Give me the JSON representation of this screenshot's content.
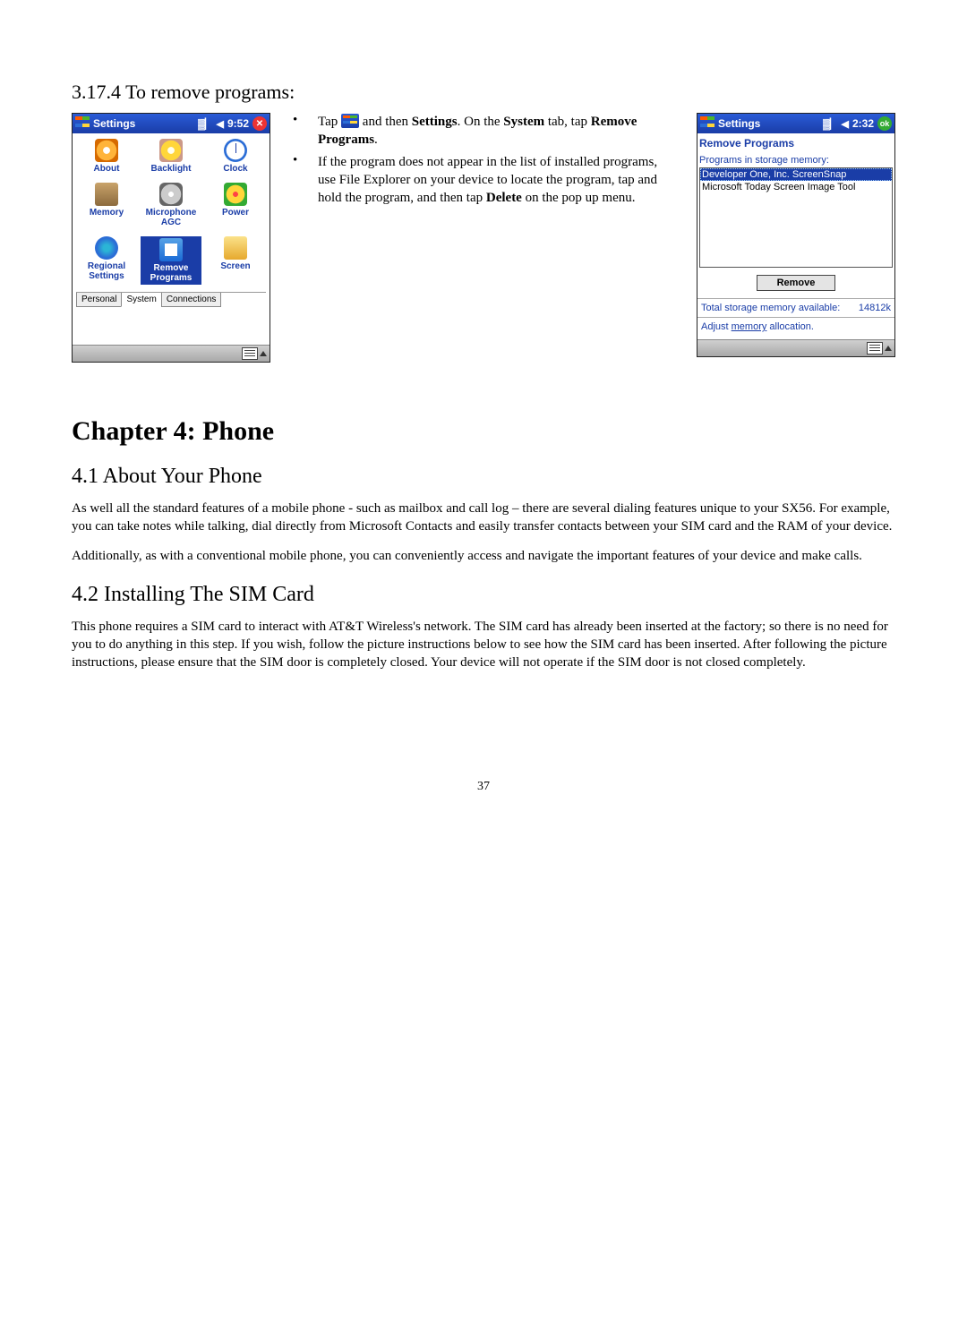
{
  "section_heading": "3.17.4  To remove programs:",
  "settings_screen": {
    "title": "Settings",
    "time": "9:52",
    "close_symbol": "✕",
    "icons": [
      {
        "label": "About",
        "name": "about-icon",
        "cls": "gi-about"
      },
      {
        "label": "Backlight",
        "name": "backlight-icon",
        "cls": "gi-backlight"
      },
      {
        "label": "Clock",
        "name": "clock-icon",
        "cls": "gi-clock"
      },
      {
        "label": "Memory",
        "name": "memory-icon",
        "cls": "gi-memory"
      },
      {
        "label": "Microphone AGC",
        "name": "microphone-icon",
        "cls": "gi-mic"
      },
      {
        "label": "Power",
        "name": "power-icon",
        "cls": "gi-power"
      },
      {
        "label": "Regional Settings",
        "name": "regional-icon",
        "cls": "gi-regional"
      },
      {
        "label": "Remove Programs",
        "name": "remove-programs-icon",
        "cls": "gi-remove",
        "selected": true
      },
      {
        "label": "Screen",
        "name": "screen-icon",
        "cls": "gi-screen"
      }
    ],
    "tabs": [
      "Personal",
      "System",
      "Connections"
    ],
    "active_tab": "System"
  },
  "bullets": {
    "b1_prefix": "Tap ",
    "b1_mid": " and then ",
    "b1_settings": "Settings",
    "b1_line2a": ". On the ",
    "b1_system": "System",
    "b1_line2b": " tab, tap ",
    "b1_remove_programs": "Remove Programs",
    "b1_line2c": ".",
    "b2_a": "If the program does not appear in the list of installed programs, use File Explorer on your device to locate the program, tap and hold the program, and then tap ",
    "b2_delete": "Delete",
    "b2_b": " on the pop up menu."
  },
  "remove_screen": {
    "title": "Settings",
    "time": "2:32",
    "ok_label": "ok",
    "heading": "Remove Programs",
    "list_label": "Programs in storage memory:",
    "items": [
      {
        "text": "Developer One, Inc. ScreenSnap",
        "selected": true
      },
      {
        "text": "Microsoft Today Screen Image Tool",
        "selected": false
      }
    ],
    "remove_btn": "Remove",
    "total_label": "Total storage memory available:",
    "total_value": "14812k",
    "adjust_prefix": "Adjust ",
    "adjust_link": "memory",
    "adjust_suffix": " allocation."
  },
  "chapter_title": "Chapter 4: Phone",
  "sec41_title": "4.1 About Your Phone",
  "sec41_p1": "As well all the standard features of a mobile phone - such as mailbox and call log – there are several dialing features unique to your SX56. For example, you can take notes while talking, dial directly from Microsoft Contacts and easily transfer contacts between your SIM card and the RAM of your device.",
  "sec41_p2": "Additionally, as with a conventional mobile phone, you can conveniently access and navigate the important features of your device and make calls.",
  "sec42_title": "4.2 Installing The SIM Card",
  "sec42_p1": "This phone requires a SIM card to interact with AT&T Wireless's network.  The SIM card has already been inserted at the factory; so there is no need for you to do anything in this step.  If you wish, follow the picture instructions below to see how the SIM card has been inserted.  After following the picture instructions, please ensure that the SIM door is completely closed.  Your device will not operate if the SIM door is not closed completely.",
  "page_number": "37"
}
